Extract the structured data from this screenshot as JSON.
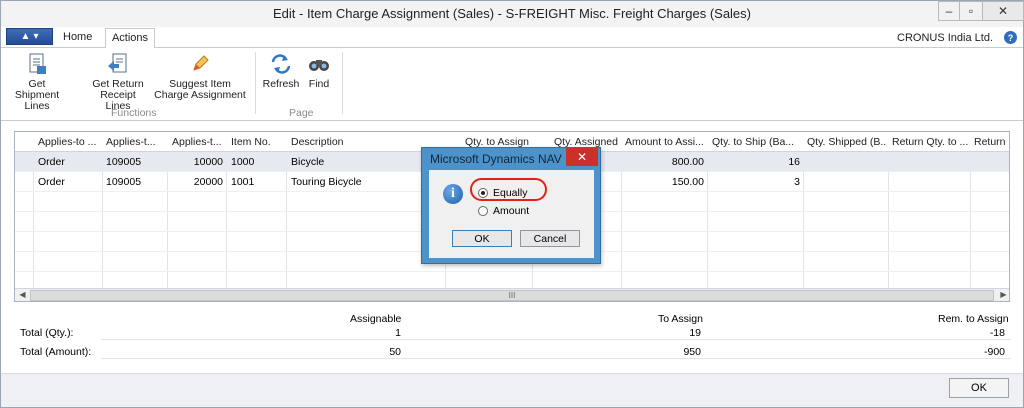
{
  "window": {
    "title": "Edit - Item Charge Assignment (Sales) - S-FREIGHT Misc. Freight Charges (Sales)",
    "controls": {
      "minimize": "–",
      "maximize": "▫",
      "close": "✕"
    }
  },
  "ribbon": {
    "tabs": {
      "home": "Home",
      "actions": "Actions"
    },
    "company": "CRONUS India Ltd.",
    "buttons": {
      "get_shipment_lines": "Get Shipment Lines",
      "get_return_receipt_lines": "Get Return Receipt Lines",
      "suggest_item_charge_assignment": "Suggest Item Charge Assignment",
      "refresh": "Refresh",
      "find": "Find"
    },
    "groups": {
      "functions": "Functions",
      "page": "Page"
    }
  },
  "grid": {
    "columns": [
      "Applies-to ...",
      "Applies-t...",
      "Applies-t...",
      "Item No.",
      "Description",
      "Qty. to Assign",
      "Qty. Assigned",
      "Amount to Assi...",
      "Qty. to Ship (Ba...",
      "Qty. Shipped (B...",
      "Return Qty. to ...",
      "Return C"
    ],
    "rows": [
      {
        "doc_type": "Order",
        "doc_no": "109005",
        "line_no": "10000",
        "item_no": "1000",
        "description": "Bicycle",
        "amount_to_assign": "800.00",
        "qty_to_ship": "16"
      },
      {
        "doc_type": "Order",
        "doc_no": "109005",
        "line_no": "20000",
        "item_no": "1001",
        "description": "Touring Bicycle",
        "amount_to_assign": "150.00",
        "qty_to_ship": "3"
      }
    ],
    "scroll_thumb": "III"
  },
  "totals": {
    "headers": {
      "assignable": "Assignable",
      "to_assign": "To Assign",
      "rem_to_assign": "Rem. to Assign"
    },
    "qty": {
      "label": "Total (Qty.):",
      "assignable": "1",
      "to_assign": "19",
      "rem_to_assign": "-18"
    },
    "amount": {
      "label": "Total (Amount):",
      "assignable": "50",
      "to_assign": "950",
      "rem_to_assign": "-900"
    }
  },
  "footer": {
    "ok": "OK"
  },
  "dialog": {
    "title": "Microsoft Dynamics NAV",
    "close": "✕",
    "options": {
      "equally": "Equally",
      "amount": "Amount"
    },
    "selected": "Equally",
    "ok": "OK",
    "cancel": "Cancel"
  }
}
